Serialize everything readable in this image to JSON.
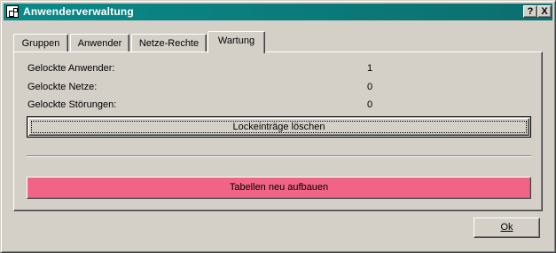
{
  "window": {
    "title": "Anwenderverwaltung",
    "help_label": "?",
    "close_label": "X"
  },
  "tabs": [
    {
      "label": "Gruppen",
      "active": false
    },
    {
      "label": "Anwender",
      "active": false
    },
    {
      "label": "Netze-Rechte",
      "active": false
    },
    {
      "label": "Wartung",
      "active": true
    }
  ],
  "wartung": {
    "rows": [
      {
        "label": "Gelockte Anwender:",
        "value": "1"
      },
      {
        "label": "Gelockte Netze:",
        "value": "0"
      },
      {
        "label": "Gelockte Störungen:",
        "value": "0"
      }
    ],
    "lock_button_label": "Lockeinträge löschen",
    "rebuild_button_label": "Tabellen neu aufbauen",
    "rebuild_button_color": "#f26486"
  },
  "footer": {
    "ok_label": "Ok"
  },
  "colors": {
    "titlebar": "#0a8a8a",
    "face": "#d4d0c8"
  }
}
